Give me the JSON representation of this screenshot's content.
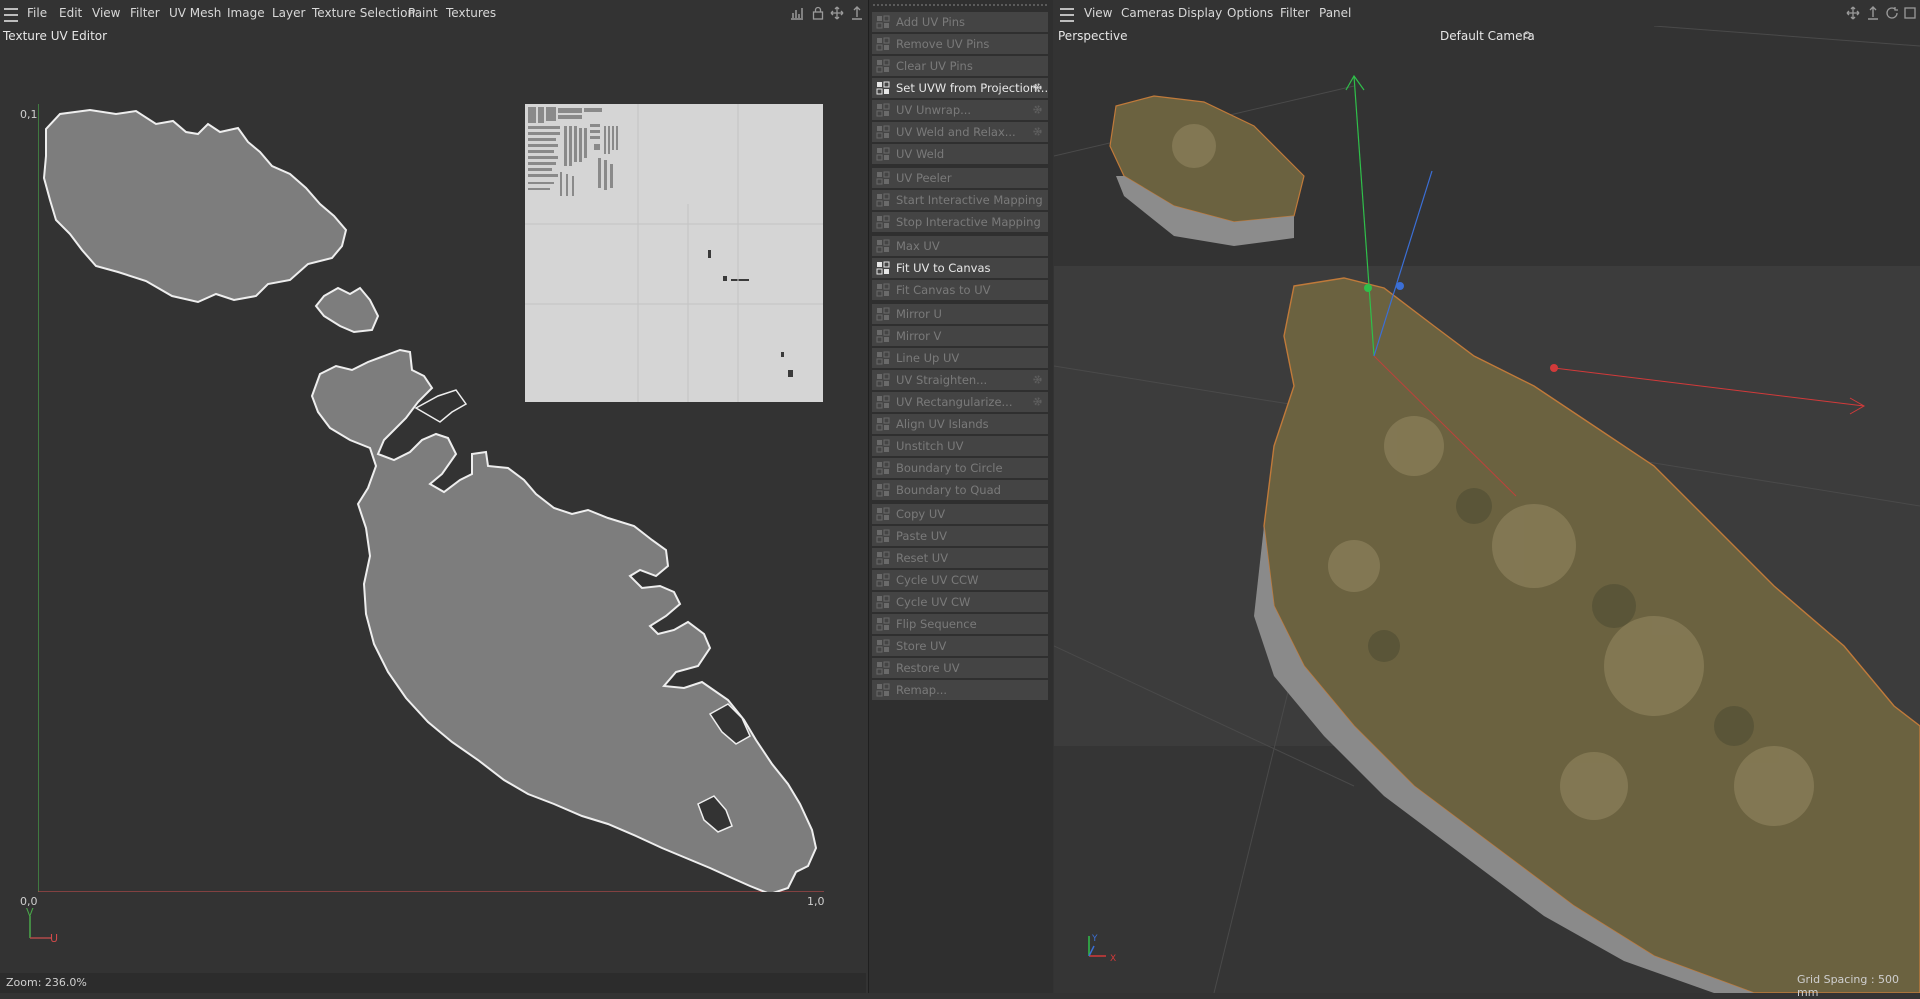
{
  "uv_editor": {
    "menu": [
      "File",
      "Edit",
      "View",
      "Filter",
      "UV Mesh",
      "Image",
      "Layer",
      "Texture Selection",
      "Paint",
      "Textures"
    ],
    "panel_title": "Texture UV Editor",
    "axis": {
      "top_left": "0,1",
      "bottom_left": "0,0",
      "bottom_right": "1,0",
      "v_label": "V",
      "u_label": "U"
    },
    "zoom": "Zoom: 236.0%"
  },
  "tools": {
    "items": [
      {
        "label": "Add UV Pins",
        "enabled": false,
        "gear": false
      },
      {
        "label": "Remove UV Pins",
        "enabled": false,
        "gear": false
      },
      {
        "label": "Clear UV Pins",
        "enabled": false,
        "gear": false
      },
      {
        "label": "Set UVW from Projection...",
        "enabled": true,
        "gear": true
      },
      {
        "label": "UV Unwrap...",
        "enabled": false,
        "gear": true
      },
      {
        "label": "UV Weld and Relax...",
        "enabled": false,
        "gear": true
      },
      {
        "label": "UV Weld",
        "enabled": false,
        "gear": false
      },
      {
        "label": "UV Peeler",
        "enabled": false,
        "gear": false
      },
      {
        "label": "Start Interactive Mapping",
        "enabled": false,
        "gear": false
      },
      {
        "label": "Stop Interactive Mapping",
        "enabled": false,
        "gear": false
      },
      {
        "label": "Max UV",
        "enabled": false,
        "gear": false
      },
      {
        "label": "Fit UV to Canvas",
        "enabled": true,
        "gear": false
      },
      {
        "label": "Fit Canvas to UV",
        "enabled": false,
        "gear": false
      },
      {
        "label": "Mirror U",
        "enabled": false,
        "gear": false
      },
      {
        "label": "Mirror V",
        "enabled": false,
        "gear": false
      },
      {
        "label": "Line Up UV",
        "enabled": false,
        "gear": false
      },
      {
        "label": "UV Straighten...",
        "enabled": false,
        "gear": true
      },
      {
        "label": "UV Rectangularize...",
        "enabled": false,
        "gear": true
      },
      {
        "label": "Align UV Islands",
        "enabled": false,
        "gear": false
      },
      {
        "label": "Unstitch UV",
        "enabled": false,
        "gear": false
      },
      {
        "label": "Boundary to Circle",
        "enabled": false,
        "gear": false
      },
      {
        "label": "Boundary to Quad",
        "enabled": false,
        "gear": false
      },
      {
        "label": "Copy UV",
        "enabled": false,
        "gear": false
      },
      {
        "label": "Paste UV",
        "enabled": false,
        "gear": false
      },
      {
        "label": "Reset UV",
        "enabled": false,
        "gear": false
      },
      {
        "label": "Cycle UV CCW",
        "enabled": false,
        "gear": false
      },
      {
        "label": "Cycle UV CW",
        "enabled": false,
        "gear": false
      },
      {
        "label": "Flip Sequence",
        "enabled": false,
        "gear": false
      },
      {
        "label": "Store UV",
        "enabled": false,
        "gear": false
      },
      {
        "label": "Restore UV",
        "enabled": false,
        "gear": false
      },
      {
        "label": "Remap...",
        "enabled": false,
        "gear": false
      }
    ]
  },
  "viewport": {
    "menu": [
      "View",
      "Cameras",
      "Display",
      "Options",
      "Filter",
      "Panel"
    ],
    "view_label": "Perspective",
    "camera_label": "Default Camera",
    "grid_spacing": "Grid Spacing : 500 mm",
    "axis_y": "Y",
    "axis_x": "X"
  },
  "colors": {
    "panel_bg": "#333333",
    "uv_island_fill": "#7d7d7d",
    "uv_island_stroke": "#e8e8e8",
    "u_axis": "#b24a4a",
    "v_axis": "#4aa84a",
    "gizmo_x": "#d23a3a",
    "gizmo_y": "#2fbf4a",
    "gizmo_z": "#3b6fd6",
    "terrain": "#6b6240"
  }
}
